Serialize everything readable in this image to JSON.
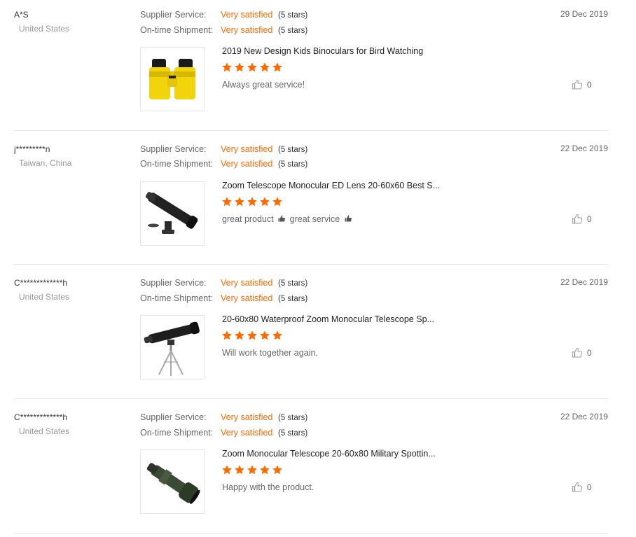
{
  "labels": {
    "supplier_service": "Supplier Service:",
    "ontime_shipment": "On-time Shipment:"
  },
  "colors": {
    "accent": "#ff6a00",
    "divider": "#e5e5e5",
    "muted": "#999999"
  },
  "reviews": [
    {
      "buyer": "A*S",
      "country": "United States",
      "date": "29 Dec 2019",
      "supplier_service": {
        "value": "Very satisfied",
        "note": "(5 stars)"
      },
      "ontime_shipment": {
        "value": "Very satisfied",
        "note": "(5 stars)"
      },
      "product_title": "2019 New Design Kids Binoculars for Bird Watching",
      "product_rating": 5,
      "comment": "Always great service!",
      "helpful_count": "0",
      "thumb_icon": "yellow-binoculars"
    },
    {
      "buyer": "j*********n",
      "country": "Taiwan, China",
      "date": "22 Dec 2019",
      "supplier_service": {
        "value": "Very satisfied",
        "note": "(5 stars)"
      },
      "ontime_shipment": {
        "value": "Very satisfied",
        "note": "(5 stars)"
      },
      "product_title": "Zoom Telescope Monocular ED Lens 20-60x60 Best S...",
      "product_rating": 5,
      "comment_parts": [
        "great product",
        "great service"
      ],
      "helpful_count": "0",
      "thumb_icon": "spotting-scope-tabletop"
    },
    {
      "buyer": "C*************h",
      "country": "United States",
      "date": "22 Dec 2019",
      "supplier_service": {
        "value": "Very satisfied",
        "note": "(5 stars)"
      },
      "ontime_shipment": {
        "value": "Very satisfied",
        "note": "(5 stars)"
      },
      "product_title": "20-60x80 Waterproof Zoom Monocular Telescope Sp...",
      "product_rating": 5,
      "comment": "Will work together again.",
      "helpful_count": "0",
      "thumb_icon": "spotting-scope-tripod"
    },
    {
      "buyer": "C*************h",
      "country": "United States",
      "date": "22 Dec 2019",
      "supplier_service": {
        "value": "Very satisfied",
        "note": "(5 stars)"
      },
      "ontime_shipment": {
        "value": "Very satisfied",
        "note": "(5 stars)"
      },
      "product_title": "Zoom Monocular Telescope 20-60x80 Military Spottin...",
      "product_rating": 5,
      "comment": "Happy with the product.",
      "helpful_count": "0",
      "thumb_icon": "spotting-scope-military"
    }
  ]
}
